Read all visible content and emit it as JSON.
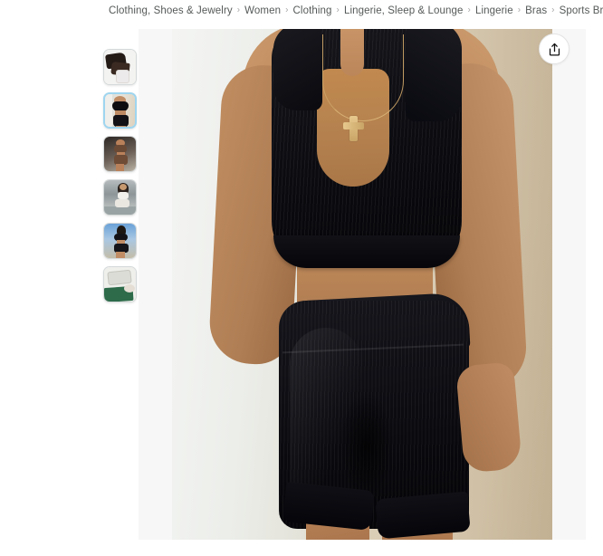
{
  "breadcrumb": {
    "separator": "›",
    "items": [
      {
        "label": "Clothing, Shoes & Jewelry"
      },
      {
        "label": "Women"
      },
      {
        "label": "Clothing"
      },
      {
        "label": "Lingerie, Sleep & Lounge"
      },
      {
        "label": "Lingerie"
      },
      {
        "label": "Bras"
      },
      {
        "label": "Sports Bras"
      }
    ]
  },
  "gallery": {
    "share_icon": "share-icon",
    "selected_index": 1,
    "thumbnails": [
      {
        "alt": "Black ribbed two-piece set flat lay on white background",
        "variant": "flatlay-dark-garment"
      },
      {
        "alt": "Model wearing black ribbed sports bra and biker shorts against beige wall",
        "variant": "model-black-set-wall"
      },
      {
        "alt": "Model wearing brown ribbed sports bra and shorts outdoors",
        "variant": "model-brown-set-outdoor"
      },
      {
        "alt": "Model wearing white ribbed sports bra and shorts indoors",
        "variant": "model-white-set-indoor"
      },
      {
        "alt": "Model wearing black ribbed set outdoors under blue sky",
        "variant": "model-black-set-sky"
      },
      {
        "alt": "Product packaging with green wrap",
        "variant": "packaging-green"
      }
    ],
    "main_image": {
      "alt": "Model wearing black ribbed notched V-neck sports bra and high-waist biker shorts with gold cross necklace",
      "wall_color": "#ded3bd",
      "garment_color": "#0b0b10",
      "skin_color": "#bb8659",
      "necklace_color": "#d9b478"
    }
  },
  "colors": {
    "page_background": "#ffffff",
    "stage_background": "#f7f7f7",
    "breadcrumb_text": "#565959",
    "breadcrumb_separator": "#a6a6a6",
    "thumb_border": "#d5d9d9",
    "thumb_selected_border": "#9fd5ef"
  }
}
